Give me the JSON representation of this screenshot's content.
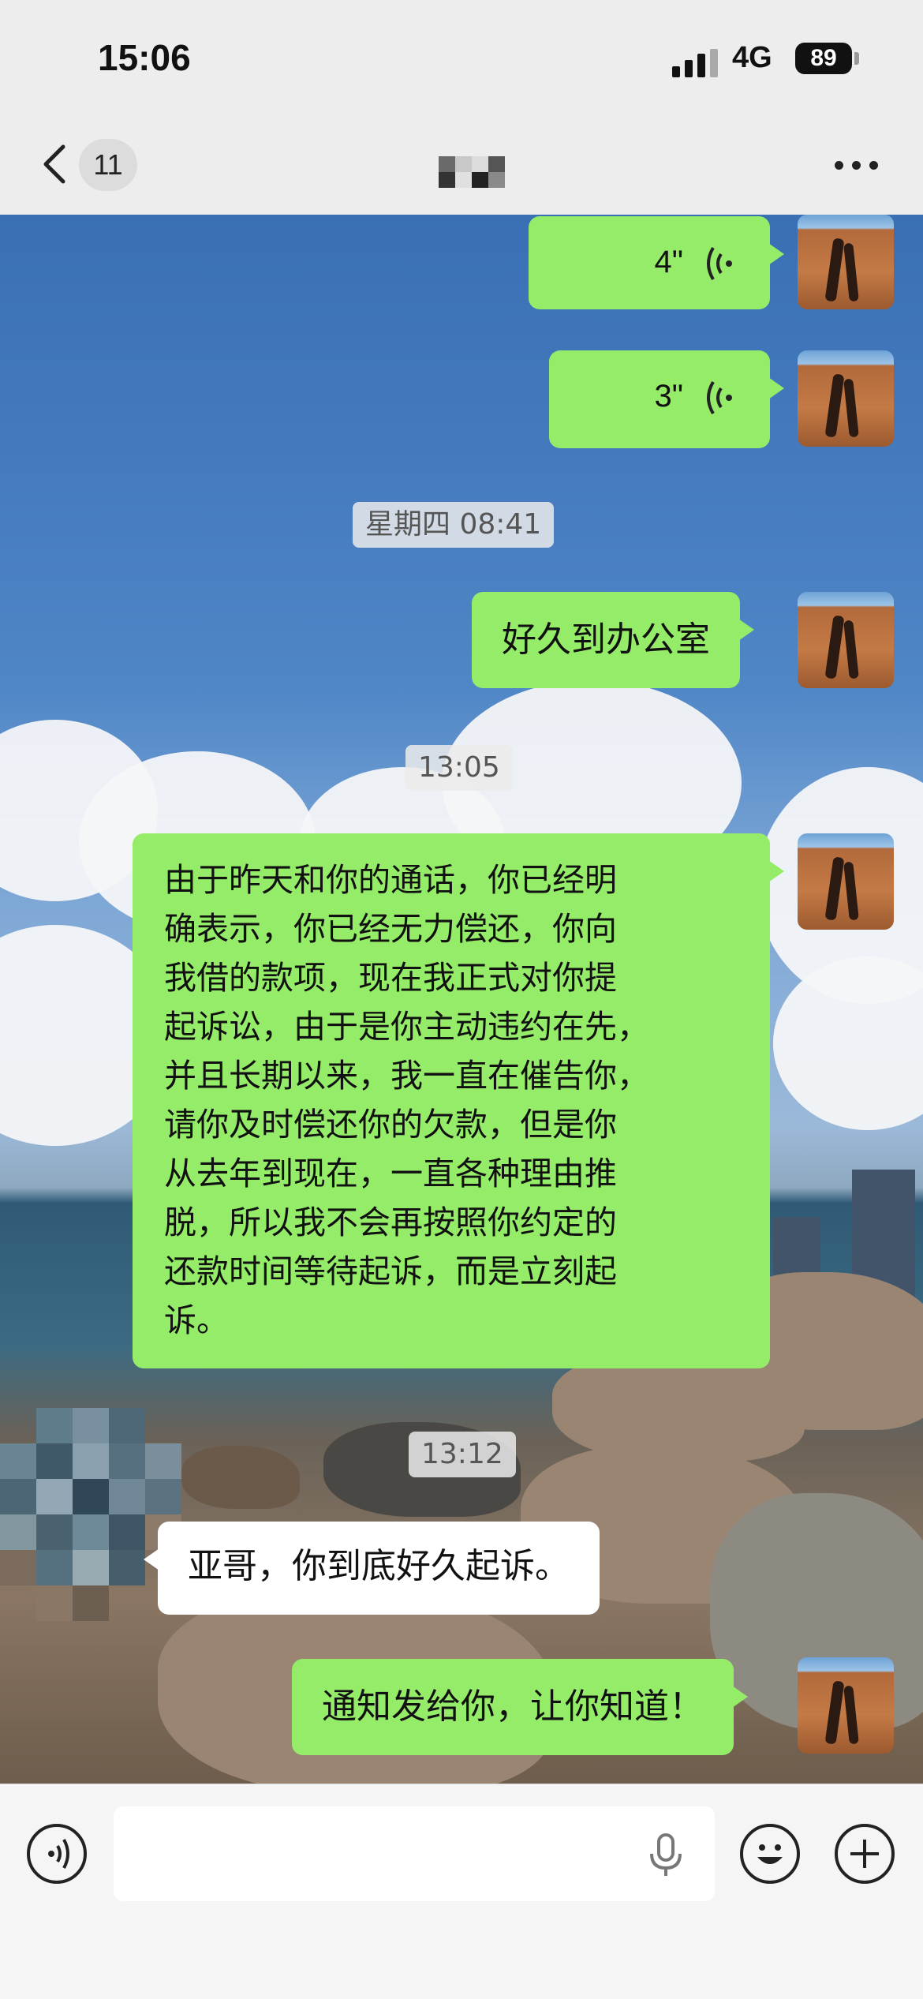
{
  "status_bar": {
    "time": "15:06",
    "network": "4G",
    "battery": "89"
  },
  "nav": {
    "unread_count": "11"
  },
  "messages": [
    {
      "type": "voice",
      "side": "out",
      "duration": "4\""
    },
    {
      "type": "voice",
      "side": "out",
      "duration": "3\""
    },
    {
      "type": "timestamp",
      "text": "星期四 08:41"
    },
    {
      "type": "text",
      "side": "out",
      "text": "好久到办公室"
    },
    {
      "type": "timestamp",
      "text": "13:05"
    },
    {
      "type": "text",
      "side": "out",
      "lines": [
        "由于昨天和你的通话，你已经明",
        "确表示，你已经无力偿还，你向",
        "我借的款项，现在我正式对你提",
        "起诉讼，由于是你主动违约在先，",
        "并且长期以来，我一直在催告你，",
        "请你及时偿还你的欠款，但是你",
        "从去年到现在，一直各种理由推",
        "脱，所以我不会再按照你约定的",
        "还款时间等待起诉，而是立刻起",
        "诉。"
      ]
    },
    {
      "type": "timestamp",
      "text": "13:12"
    },
    {
      "type": "text",
      "side": "in",
      "text": "亚哥，你到底好久起诉。"
    },
    {
      "type": "text",
      "side": "out",
      "text": "通知发给你，让你知道！"
    }
  ],
  "icons": {
    "back": "chevron-left-icon",
    "more": "more-dots-icon",
    "voice_toggle": "voice-mode-icon",
    "mic": "microphone-icon",
    "emoji": "emoji-icon",
    "add": "plus-icon"
  },
  "colors": {
    "outgoing_bubble": "#95ec69",
    "incoming_bubble": "#ffffff",
    "bar": "#ededed"
  }
}
